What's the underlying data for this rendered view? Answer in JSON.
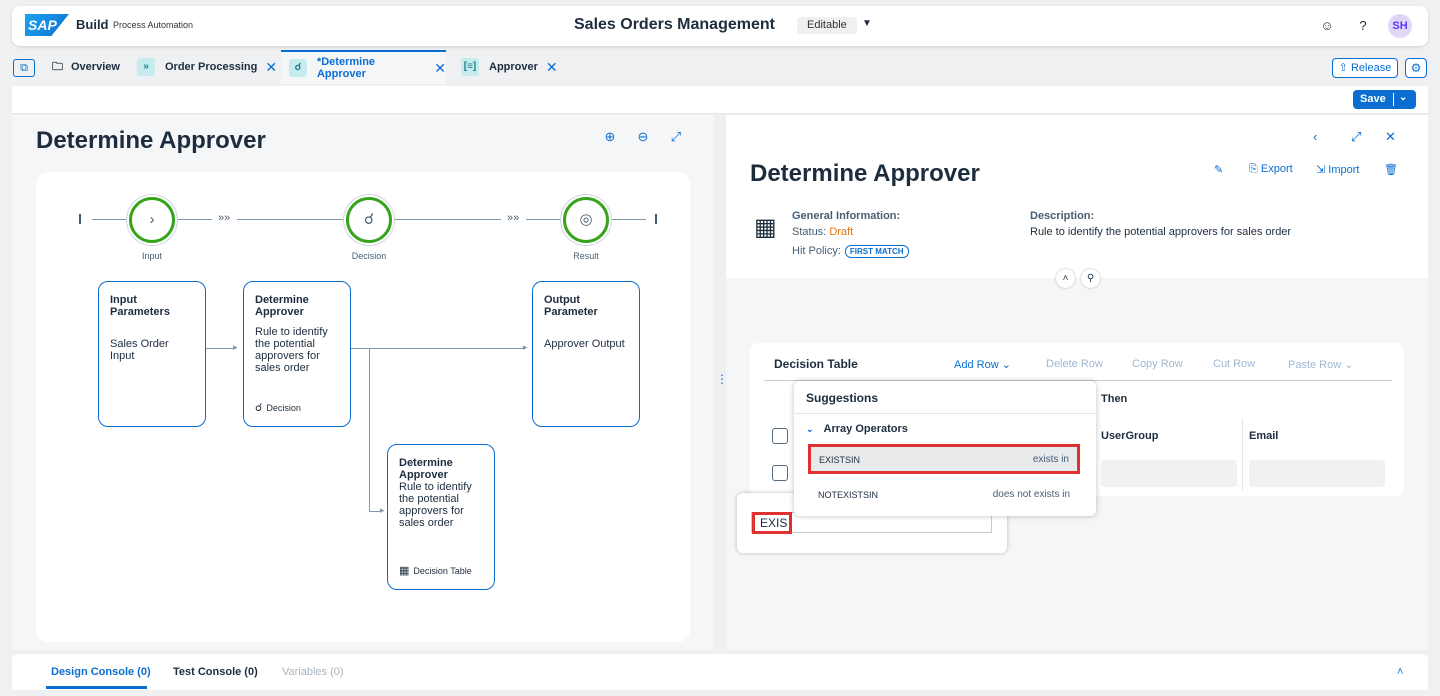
{
  "shell": {
    "logo": "SAP",
    "brand": "Build",
    "brand_sub": "Process Automation",
    "title": "Sales Orders Management",
    "mode": "Editable",
    "avatar": "SH"
  },
  "tabs": [
    {
      "label": "Overview"
    },
    {
      "label": "Order Processing"
    },
    {
      "label": "*Determine Approver"
    },
    {
      "label": "Approver"
    }
  ],
  "toolbar": {
    "release_label": "Release",
    "save_label": "Save"
  },
  "left": {
    "title": "Determine Approver",
    "flow": {
      "input_label": "Input",
      "decision_label": "Decision",
      "result_label": "Result"
    },
    "nodes": {
      "input_params": {
        "title": "Input Parameters",
        "body": "Sales Order Input"
      },
      "decision": {
        "title": "Determine Approver",
        "body": "Rule to identify the potential approvers for sales order",
        "footer": "Decision"
      },
      "output": {
        "title": "Output Parameter",
        "body": "Approver Output"
      },
      "decision_table": {
        "title": "Determine Approver",
        "body": "Rule to identify the potential approvers for sales order",
        "footer": "Decision Table"
      }
    }
  },
  "right": {
    "title": "Determine Approver",
    "export_label": "Export",
    "import_label": "Import",
    "general_info_label": "General Information:",
    "status_label": "Status:",
    "status_value": "Draft",
    "hit_policy_label": "Hit Policy:",
    "hit_policy_value": "FIRST MATCH",
    "description_label": "Description:",
    "description_value": "Rule to identify the potential approvers for sales order"
  },
  "decision_table": {
    "title": "Decision Table",
    "actions": {
      "add_row": "Add Row",
      "delete_row": "Delete Row",
      "copy_row": "Copy Row",
      "cut_row": "Cut Row",
      "paste_row": "Paste Row"
    },
    "then_label": "Then",
    "columns": [
      "UserGroup",
      "Email"
    ]
  },
  "editor": {
    "value": "EXIS"
  },
  "suggestions": {
    "title": "Suggestions",
    "group": "Array Operators",
    "items": [
      {
        "code": "EXISTSIN",
        "desc": "exists in"
      },
      {
        "code": "NOTEXISTSIN",
        "desc": "does not exists in"
      }
    ]
  },
  "console": {
    "tabs": [
      {
        "label": "Design Console (0)"
      },
      {
        "label": "Test Console (0)"
      },
      {
        "label": "Variables (0)"
      }
    ]
  }
}
